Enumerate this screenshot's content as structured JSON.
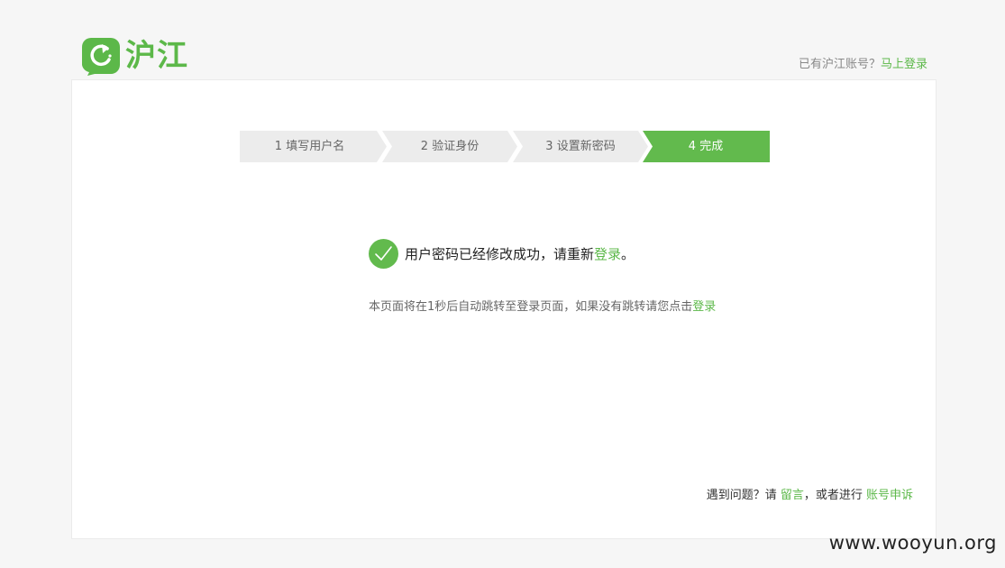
{
  "header": {
    "brand": "沪江",
    "account_prompt": "已有沪江账号？",
    "login_link": "马上登录"
  },
  "steps": [
    {
      "label": "1 填写用户名",
      "active": false
    },
    {
      "label": "2 验证身份",
      "active": false
    },
    {
      "label": "3 设置新密码",
      "active": false
    },
    {
      "label": "4 完成",
      "active": true
    }
  ],
  "success": {
    "message": "用户密码已经修改成功，请重新",
    "login_link": "登录",
    "period": "。"
  },
  "redirect": {
    "text": "本页面将在1秒后自动跳转至登录页面，如果没有跳转请您点击",
    "link": "登录"
  },
  "footer": {
    "prefix": "遇到问题？请 ",
    "message_link": "留言",
    "middle": "，或者进行 ",
    "appeal_link": "账号申诉"
  },
  "watermark": "www.wooyun.org",
  "colors": {
    "accent": "#5cb849",
    "step_inactive": "#ececec",
    "step_active": "#62ba4d"
  }
}
